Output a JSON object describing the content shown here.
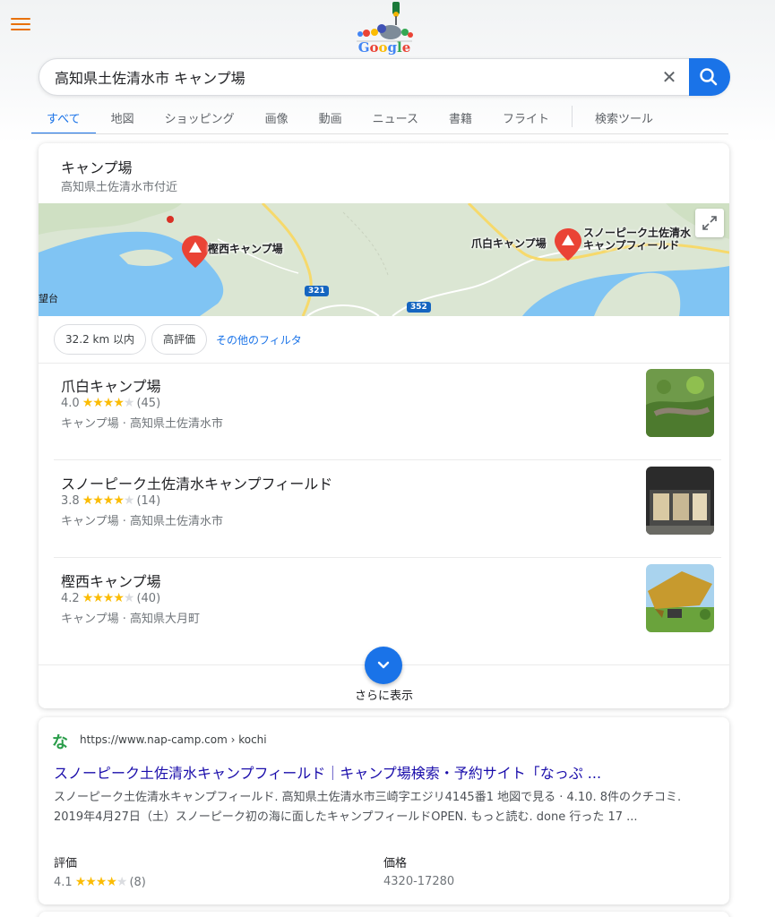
{
  "header": {
    "logo_text": "Google",
    "search": {
      "query": "高知県土佐清水市 キャンプ場",
      "clear_symbol": "✕"
    },
    "tabs": [
      {
        "label": "すべて",
        "active": true
      },
      {
        "label": "地図"
      },
      {
        "label": "ショッピング"
      },
      {
        "label": "画像"
      },
      {
        "label": "動画"
      },
      {
        "label": "ニュース"
      },
      {
        "label": "書籍"
      },
      {
        "label": "フライト"
      },
      {
        "label": "検索ツール"
      }
    ]
  },
  "local_pack": {
    "title": "キャンプ場",
    "subtitle": "高知県土佐清水市付近",
    "map": {
      "pins": [
        {
          "label": "樫西キャンプ場"
        },
        {
          "label": "爪白キャンプ場"
        },
        {
          "label": "スノーピーク土佐清水",
          "label2": "キャンプフィールド"
        }
      ],
      "side_label": "望台",
      "roads": [
        "321",
        "352"
      ]
    },
    "filters": {
      "chips": [
        "32.2 km 以内",
        "高評価"
      ],
      "more": "その他のフィルタ"
    },
    "results": [
      {
        "name": "爪白キャンプ場",
        "rating": "4.0",
        "stars": 4,
        "count": "(45)",
        "meta": "キャンプ場 · 高知県土佐清水市"
      },
      {
        "name": "スノーピーク土佐清水キャンプフィールド",
        "rating": "3.8",
        "stars": 4,
        "count": "(14)",
        "meta": "キャンプ場 · 高知県土佐清水市"
      },
      {
        "name": "樫西キャンプ場",
        "rating": "4.2",
        "stars": 4,
        "count": "(40)",
        "meta": "キャンプ場 · 高知県大月町"
      }
    ],
    "more_label": "さらに表示"
  },
  "web_result": {
    "favicon": "な",
    "url": "https://www.nap-camp.com › kochi",
    "title": "スノーピーク土佐清水キャンプフィールド｜キャンプ場検索・予約サイト「なっぷ ...",
    "snippet": "スノーピーク土佐清水キャンプフィールド. 高知県土佐清水市三崎字エジリ4145番1 地図で見る · 4.10. 8件のクチコミ. 2019年4月27日（土）スノーピーク初の海に面したキャンプフィールドOPEN. もっと読む. done 行った 17 ...",
    "rating_label": "評価",
    "rating_value": "4.1",
    "rating_stars": 4,
    "rating_count": "(8)",
    "price_label": "価格",
    "price_value": "4320-17280"
  },
  "colors": {
    "accent": "#1a73e8",
    "link": "#1a0dab",
    "star": "#fbbc04",
    "pin": "#ea4335",
    "menu": "#e8710a"
  }
}
